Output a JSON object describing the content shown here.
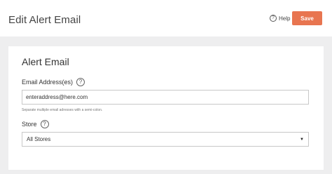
{
  "header": {
    "title": "Edit Alert Email",
    "help_label": "Help",
    "help_icon_glyph": "?",
    "save_label": "Save"
  },
  "panel": {
    "title": "Alert Email",
    "email": {
      "label": "Email Address(es)",
      "help_glyph": "?",
      "value": "enteraddress@here.com",
      "hint": "Separate multiple email adresses with a semi-colon."
    },
    "store": {
      "label": "Store",
      "help_glyph": "?",
      "selected": "All Stores",
      "caret_glyph": "▼"
    }
  },
  "colors": {
    "accent": "#e87550",
    "background": "#eeeeef"
  }
}
